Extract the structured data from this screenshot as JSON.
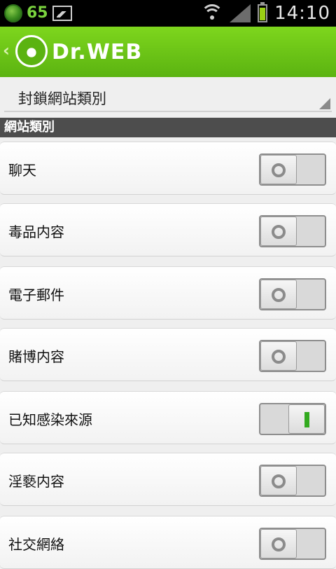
{
  "status_bar": {
    "left_number": "65",
    "time": "14:10"
  },
  "app_bar": {
    "title": "Dr.WEB"
  },
  "dropdown": {
    "selected": "封鎖網站類別"
  },
  "section": {
    "header": "網站類別"
  },
  "categories": [
    {
      "label": "聊天",
      "enabled": false
    },
    {
      "label": "毒品内容",
      "enabled": false
    },
    {
      "label": "電子郵件",
      "enabled": false
    },
    {
      "label": "賭博内容",
      "enabled": false
    },
    {
      "label": "已知感染來源",
      "enabled": true
    },
    {
      "label": "淫褻内容",
      "enabled": false
    },
    {
      "label": "社交網絡",
      "enabled": false
    }
  ],
  "colors": {
    "brand_green": "#5bb311",
    "toggle_on_indicator": "#33aa1f"
  },
  "icons": {
    "status_left": [
      "dr-web-badge-icon",
      "image-icon"
    ],
    "status_right": [
      "wifi-icon",
      "signal-icon",
      "battery-icon"
    ]
  }
}
